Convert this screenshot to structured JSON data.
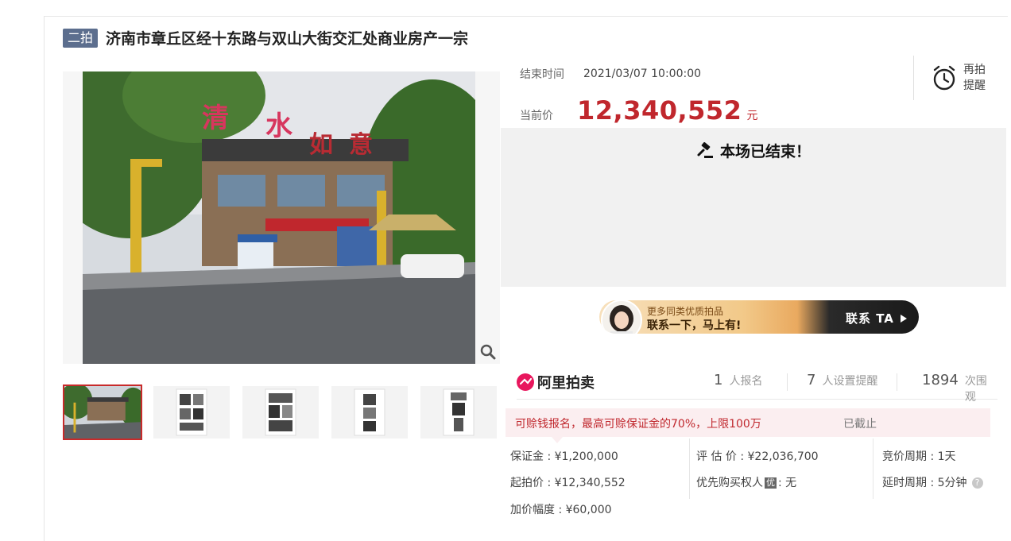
{
  "header": {
    "round_badge": "二拍",
    "title": "济南市章丘区经十东路与双山大街交汇处商业房产一宗"
  },
  "auction": {
    "end_time_label": "结束时间",
    "end_time": "2021/03/07 10:00:00",
    "current_price_label": "当前价",
    "current_price": "12,340,552",
    "price_unit": "元",
    "remind_line1": "再拍",
    "remind_line2": "提醒",
    "ended_message": "本场已结束！"
  },
  "promo": {
    "line1": "更多同类优质拍品",
    "line2": "联系一下，马上有!",
    "cta": "联系 TA"
  },
  "stats": {
    "brand": "阿里拍卖",
    "signups_num": "1",
    "signups_unit": "人报名",
    "reminders_num": "7",
    "reminders_unit": "人设置提醒",
    "views_num": "1894",
    "views_unit": "次围观"
  },
  "refund": {
    "text": "可赊钱报名，最高可赊保证金的70%，上限100万",
    "status": "已截止"
  },
  "details": {
    "deposit": "保证金 : ¥1,200,000",
    "start_price": "起拍价 : ¥12,340,552",
    "increment": "加价幅度 : ¥60,000",
    "appraisal": "评 估 价 : ¥22,036,700",
    "priority_label": "优先购买权人",
    "priority_badge": "优",
    "priority_value": ": 无",
    "bid_cycle": "竞价周期 : 1天",
    "delay_cycle": "延时周期 : 5分钟",
    "help_glyph": "?"
  },
  "colors": {
    "price_red": "#c0272d",
    "badge_blue": "#5c6e8e",
    "thumb_active_border": "#c82a2a"
  },
  "icons": {
    "zoom": "magnifier-icon",
    "remind": "alarm-clock-icon",
    "ended": "gavel-icon",
    "brand": "ali-auction-logo",
    "cta_arrow": "triangle-right-icon",
    "help": "question-circle-icon"
  }
}
